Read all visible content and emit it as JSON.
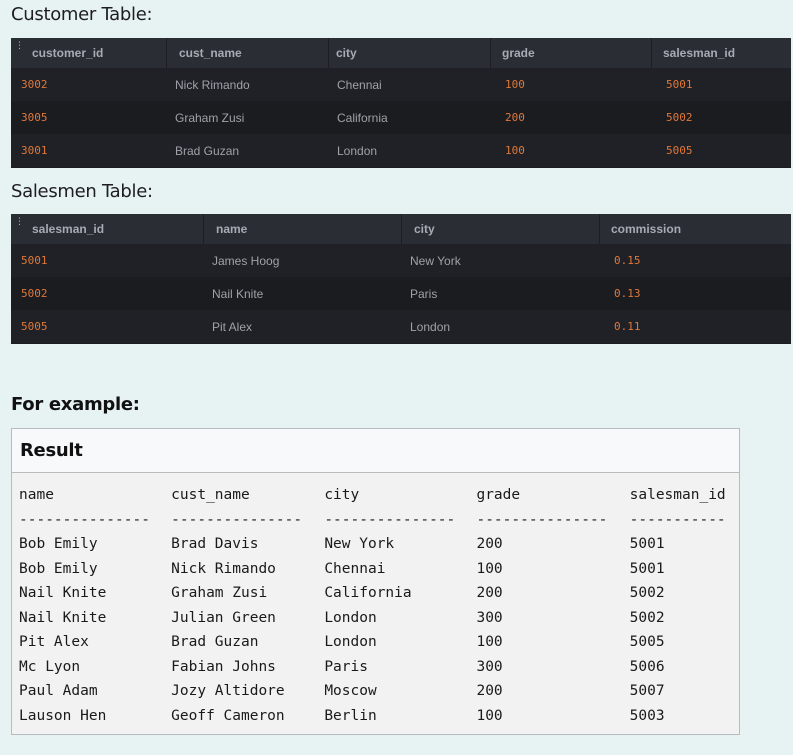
{
  "customer": {
    "title": "Customer Table:",
    "columns": [
      "customer_id",
      "cust_name",
      "city",
      "grade",
      "salesman_id"
    ],
    "rows": [
      [
        "3002",
        "Nick Rimando",
        "Chennai",
        "100",
        "5001"
      ],
      [
        "3005",
        "Graham Zusi",
        "California",
        "200",
        "5002"
      ],
      [
        "3001",
        "Brad Guzan",
        "London",
        "100",
        "5005"
      ]
    ]
  },
  "salesmen": {
    "title": "Salesmen Table:",
    "columns": [
      "salesman_id",
      "name",
      "city",
      "commission"
    ],
    "rows": [
      [
        "5001",
        "James Hoog",
        "New York",
        "0.15"
      ],
      [
        "5002",
        "Nail Knite",
        "Paris",
        "0.13"
      ],
      [
        "5005",
        "Pit Alex",
        "London",
        "0.11"
      ]
    ]
  },
  "example": {
    "label": "For example:",
    "result_title": "Result",
    "columns": [
      "name",
      "cust_name",
      "city",
      "grade",
      "salesman_id"
    ],
    "separators": [
      "---------------",
      "---------------",
      "---------------",
      "---------------",
      "-----------"
    ],
    "rows": [
      [
        "Bob Emily",
        "Brad Davis",
        "New York",
        "200",
        "5001"
      ],
      [
        "Bob Emily",
        "Nick Rimando",
        "Chennai",
        "100",
        "5001"
      ],
      [
        "Nail Knite",
        "Graham Zusi",
        "California",
        "200",
        "5002"
      ],
      [
        "Nail Knite",
        "Julian Green",
        "London",
        "300",
        "5002"
      ],
      [
        "Pit Alex",
        "Brad Guzan",
        "London",
        "100",
        "5005"
      ],
      [
        "Mc Lyon",
        "Fabian Johns",
        "Paris",
        "300",
        "5006"
      ],
      [
        "Paul Adam",
        "Jozy Altidore",
        "Moscow",
        "200",
        "5007"
      ],
      [
        "Lauson Hen",
        "Geoff Cameron",
        "Berlin",
        "100",
        "5003"
      ]
    ]
  },
  "colors": {
    "page_bg": "#e7f2f3",
    "table_bg": "#1b1d22",
    "header_bg": "#2a2d33",
    "number_accent": "#e0783a"
  }
}
